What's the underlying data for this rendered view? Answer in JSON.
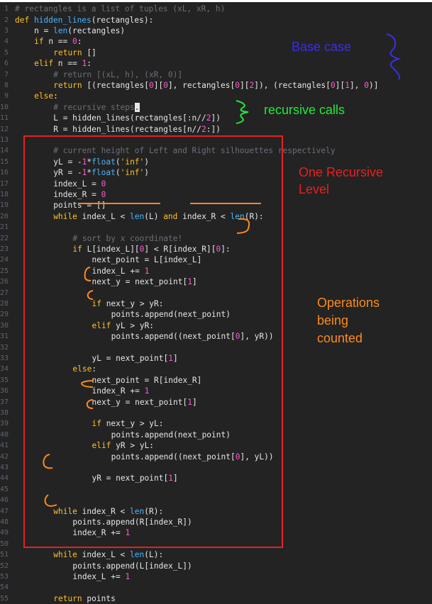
{
  "editor": {
    "lines": [
      {
        "n": "1",
        "ind": 0,
        "t": [
          [
            "cm",
            "# rectangles is a list of tuples (xL, xR, h)"
          ]
        ]
      },
      {
        "n": "2",
        "ind": 0,
        "t": [
          [
            "kw",
            "def "
          ],
          [
            "fn",
            "hidden_lines"
          ],
          [
            "p",
            "(rectangles):"
          ]
        ]
      },
      {
        "n": "3",
        "ind": 4,
        "t": [
          [
            "p",
            "n = "
          ],
          [
            "fn",
            "len"
          ],
          [
            "p",
            "(rectangles)"
          ]
        ]
      },
      {
        "n": "4",
        "ind": 4,
        "t": [
          [
            "kw",
            "if "
          ],
          [
            "p",
            "n == "
          ],
          [
            "num",
            "0"
          ],
          [
            "p",
            ":"
          ]
        ]
      },
      {
        "n": "5",
        "ind": 8,
        "t": [
          [
            "kw",
            "return "
          ],
          [
            "p",
            "[]"
          ]
        ]
      },
      {
        "n": "6",
        "ind": 4,
        "t": [
          [
            "kw",
            "elif "
          ],
          [
            "p",
            "n == "
          ],
          [
            "num",
            "1"
          ],
          [
            "p",
            ":"
          ]
        ]
      },
      {
        "n": "7",
        "ind": 8,
        "t": [
          [
            "cm",
            "# return [(xL, h), (xR, 0)]"
          ]
        ]
      },
      {
        "n": "8",
        "ind": 8,
        "t": [
          [
            "kw",
            "return "
          ],
          [
            "p",
            "[(rectangles["
          ],
          [
            "num",
            "0"
          ],
          [
            "p",
            "]["
          ],
          [
            "num",
            "0"
          ],
          [
            "p",
            "], rectangles["
          ],
          [
            "num",
            "0"
          ],
          [
            "p",
            "]["
          ],
          [
            "num",
            "2"
          ],
          [
            "p",
            "]), (rectangles["
          ],
          [
            "num",
            "0"
          ],
          [
            "p",
            "]["
          ],
          [
            "num",
            "1"
          ],
          [
            "p",
            "], "
          ],
          [
            "num",
            "0"
          ],
          [
            "p",
            ")]"
          ]
        ]
      },
      {
        "n": "9",
        "ind": 4,
        "t": [
          [
            "kw",
            "else"
          ],
          [
            "p",
            ":"
          ]
        ]
      },
      {
        "n": "10",
        "ind": 8,
        "t": [
          [
            "cm",
            "# recursive steps"
          ],
          [
            "cur",
            "."
          ]
        ]
      },
      {
        "n": "11",
        "ind": 8,
        "t": [
          [
            "p",
            "L = hidden_lines(rectangles[:n//"
          ],
          [
            "num",
            "2"
          ],
          [
            "p",
            "])"
          ]
        ]
      },
      {
        "n": "12",
        "ind": 8,
        "t": [
          [
            "p",
            "R = hidden_lines(rectangles[n//"
          ],
          [
            "num",
            "2"
          ],
          [
            "p",
            ":])"
          ]
        ]
      },
      {
        "n": "13",
        "ind": 0,
        "t": []
      },
      {
        "n": "14",
        "ind": 8,
        "t": [
          [
            "cm",
            "# current height of Left and Right silhouettes respectively"
          ]
        ]
      },
      {
        "n": "15",
        "ind": 8,
        "t": [
          [
            "p",
            "yL = -"
          ],
          [
            "num",
            "1"
          ],
          [
            "p",
            "*"
          ],
          [
            "fn",
            "float"
          ],
          [
            "p",
            "("
          ],
          [
            "str",
            "'inf'"
          ],
          [
            "p",
            ")"
          ]
        ]
      },
      {
        "n": "16",
        "ind": 8,
        "t": [
          [
            "p",
            "yR = -"
          ],
          [
            "num",
            "1"
          ],
          [
            "p",
            "*"
          ],
          [
            "fn",
            "float"
          ],
          [
            "p",
            "("
          ],
          [
            "str",
            "'inf'"
          ],
          [
            "p",
            ")"
          ]
        ]
      },
      {
        "n": "17",
        "ind": 8,
        "t": [
          [
            "p",
            "index_L = "
          ],
          [
            "num",
            "0"
          ]
        ]
      },
      {
        "n": "18",
        "ind": 8,
        "t": [
          [
            "p",
            "index_R = "
          ],
          [
            "num",
            "0"
          ]
        ]
      },
      {
        "n": "19",
        "ind": 8,
        "t": [
          [
            "p",
            "points = []"
          ]
        ]
      },
      {
        "n": "20",
        "ind": 8,
        "t": [
          [
            "kw",
            "while "
          ],
          [
            "p",
            "index_L < "
          ],
          [
            "fn",
            "len"
          ],
          [
            "p",
            "(L) "
          ],
          [
            "kw",
            "and "
          ],
          [
            "p",
            "index_R < "
          ],
          [
            "fn",
            "len"
          ],
          [
            "p",
            "(R):"
          ]
        ]
      },
      {
        "n": "21",
        "ind": 0,
        "t": []
      },
      {
        "n": "22",
        "ind": 12,
        "t": [
          [
            "cm",
            "# sort by x coordinate!"
          ]
        ]
      },
      {
        "n": "23",
        "ind": 12,
        "t": [
          [
            "kw",
            "if "
          ],
          [
            "p",
            "L[index_L]["
          ],
          [
            "num",
            "0"
          ],
          [
            "p",
            "] < R[index_R]["
          ],
          [
            "num",
            "0"
          ],
          [
            "p",
            "]:"
          ]
        ]
      },
      {
        "n": "24",
        "ind": 16,
        "t": [
          [
            "p",
            "next_point = L[index_L]"
          ]
        ]
      },
      {
        "n": "25",
        "ind": 16,
        "t": [
          [
            "p",
            "index_L += "
          ],
          [
            "num",
            "1"
          ]
        ]
      },
      {
        "n": "26",
        "ind": 16,
        "t": [
          [
            "p",
            "next_y = next_point["
          ],
          [
            "num",
            "1"
          ],
          [
            "p",
            "]"
          ]
        ]
      },
      {
        "n": "27",
        "ind": 0,
        "t": []
      },
      {
        "n": "28",
        "ind": 16,
        "t": [
          [
            "kw",
            "if "
          ],
          [
            "p",
            "next_y > yR:"
          ]
        ]
      },
      {
        "n": "29",
        "ind": 20,
        "t": [
          [
            "p",
            "points.append(next_point)"
          ]
        ]
      },
      {
        "n": "30",
        "ind": 16,
        "t": [
          [
            "kw",
            "elif "
          ],
          [
            "p",
            "yL > yR:"
          ]
        ]
      },
      {
        "n": "31",
        "ind": 20,
        "t": [
          [
            "p",
            "points.append((next_point["
          ],
          [
            "num",
            "0"
          ],
          [
            "p",
            "], yR))"
          ]
        ]
      },
      {
        "n": "32",
        "ind": 0,
        "t": []
      },
      {
        "n": "33",
        "ind": 16,
        "t": [
          [
            "p",
            "yL = next_point["
          ],
          [
            "num",
            "1"
          ],
          [
            "p",
            "]"
          ]
        ]
      },
      {
        "n": "34",
        "ind": 12,
        "t": [
          [
            "kw",
            "else"
          ],
          [
            "p",
            ":"
          ]
        ]
      },
      {
        "n": "35",
        "ind": 16,
        "t": [
          [
            "p",
            "next_point = R[index_R]"
          ]
        ]
      },
      {
        "n": "36",
        "ind": 16,
        "t": [
          [
            "p",
            "index_R += "
          ],
          [
            "num",
            "1"
          ]
        ]
      },
      {
        "n": "37",
        "ind": 16,
        "t": [
          [
            "p",
            "next_y = next_point["
          ],
          [
            "num",
            "1"
          ],
          [
            "p",
            "]"
          ]
        ]
      },
      {
        "n": "38",
        "ind": 0,
        "t": []
      },
      {
        "n": "39",
        "ind": 16,
        "t": [
          [
            "kw",
            "if "
          ],
          [
            "p",
            "next_y > yL:"
          ]
        ]
      },
      {
        "n": "40",
        "ind": 20,
        "t": [
          [
            "p",
            "points.append(next_point)"
          ]
        ]
      },
      {
        "n": "41",
        "ind": 16,
        "t": [
          [
            "kw",
            "elif "
          ],
          [
            "p",
            "yR > yL:"
          ]
        ]
      },
      {
        "n": "42",
        "ind": 20,
        "t": [
          [
            "p",
            "points.append((next_point["
          ],
          [
            "num",
            "0"
          ],
          [
            "p",
            "], yL))"
          ]
        ]
      },
      {
        "n": "43",
        "ind": 0,
        "t": []
      },
      {
        "n": "44",
        "ind": 16,
        "t": [
          [
            "p",
            "yR = next_point["
          ],
          [
            "num",
            "1"
          ],
          [
            "p",
            "]"
          ]
        ]
      },
      {
        "n": "45",
        "ind": 0,
        "t": []
      },
      {
        "n": "46",
        "ind": 0,
        "t": []
      },
      {
        "n": "47",
        "ind": 8,
        "t": [
          [
            "kw",
            "while "
          ],
          [
            "p",
            "index_R < "
          ],
          [
            "fn",
            "len"
          ],
          [
            "p",
            "(R):"
          ]
        ]
      },
      {
        "n": "48",
        "ind": 12,
        "t": [
          [
            "p",
            "points.append(R[index_R])"
          ]
        ]
      },
      {
        "n": "49",
        "ind": 12,
        "t": [
          [
            "p",
            "index_R += "
          ],
          [
            "num",
            "1"
          ]
        ]
      },
      {
        "n": "50",
        "ind": 0,
        "t": []
      },
      {
        "n": "51",
        "ind": 8,
        "t": [
          [
            "kw",
            "while "
          ],
          [
            "p",
            "index_L < "
          ],
          [
            "fn",
            "len"
          ],
          [
            "p",
            "(L):"
          ]
        ]
      },
      {
        "n": "52",
        "ind": 12,
        "t": [
          [
            "p",
            "points.append(L[index_L])"
          ]
        ]
      },
      {
        "n": "53",
        "ind": 12,
        "t": [
          [
            "p",
            "index_L += "
          ],
          [
            "num",
            "1"
          ]
        ]
      },
      {
        "n": "54",
        "ind": 0,
        "t": []
      },
      {
        "n": "55",
        "ind": 8,
        "t": [
          [
            "kw",
            "return "
          ],
          [
            "p",
            "points"
          ]
        ]
      }
    ]
  },
  "annotations": {
    "base_case": "Base case",
    "recursive_calls": "recursive calls",
    "one_recursive": "One Recursive",
    "level": "Level",
    "operations": "Operations",
    "being": "being",
    "counted": "counted"
  },
  "colors": {
    "base_case": "#3a2ee8",
    "recursive_calls": "#22e83a",
    "recursive_level": "#e82020",
    "operations": "#ff8a1a"
  }
}
